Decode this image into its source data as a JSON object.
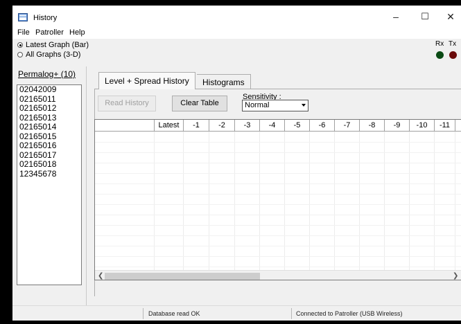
{
  "window": {
    "title": "History"
  },
  "menu": [
    "File",
    "Patroller",
    "Help"
  ],
  "graph_mode": {
    "options": [
      {
        "label": "Latest Graph (Bar)",
        "checked": true
      },
      {
        "label": "All Graphs (3-D)",
        "checked": false
      }
    ]
  },
  "indicators": {
    "rx": {
      "label": "Rx",
      "color": "#0a4a14"
    },
    "tx": {
      "label": "Tx",
      "color": "#6a0b0b"
    }
  },
  "left_pane": {
    "header": "Permalog+ (10)",
    "devices": [
      "02042009",
      "02165011",
      "02165012",
      "02165013",
      "02165014",
      "02165015",
      "02165016",
      "02165017",
      "02165018",
      "12345678"
    ]
  },
  "tabs": [
    {
      "label": "Level + Spread History",
      "active": true
    },
    {
      "label": "Histograms",
      "active": false
    }
  ],
  "toolbar": {
    "read_history": "Read History",
    "clear_table": "Clear Table",
    "sensitivity_label": "Sensitivity :",
    "sensitivity_value": "Normal"
  },
  "grid": {
    "columns": [
      "",
      "Latest",
      "-1",
      "-2",
      "-3",
      "-4",
      "-5",
      "-6",
      "-7",
      "-8",
      "-9",
      "-10",
      "-11"
    ]
  },
  "status": {
    "cell1": "",
    "cell2": "Database read OK",
    "cell3": "Connected to Patroller (USB Wireless)"
  }
}
